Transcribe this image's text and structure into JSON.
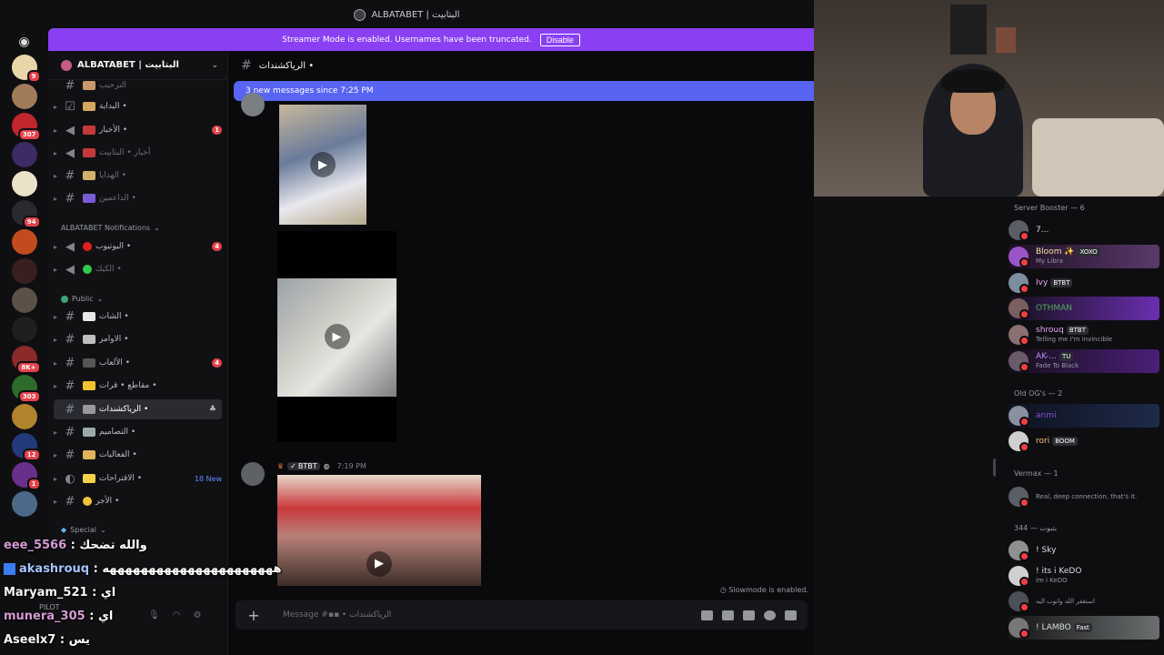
{
  "window": {
    "title": "ALBATABET | البتابيت"
  },
  "banner": {
    "text": "Streamer Mode is enabled. Usernames have been truncated.",
    "button": "Disable"
  },
  "server": {
    "name": "ALBATABET | البتابيت"
  },
  "server_rail": {
    "badges": [
      "9",
      "307",
      "94",
      "8K+",
      "303",
      "12",
      "1"
    ]
  },
  "sidebar": {
    "channels_top": [
      {
        "name": "الترحيب"
      },
      {
        "name": "البداية •"
      },
      {
        "name": "الأخبار •",
        "badge": "1"
      },
      {
        "name": "أخبار • البتابيت"
      },
      {
        "name": "الهدايا •"
      },
      {
        "name": "الداعمين •"
      }
    ],
    "category_notifications": "ALBATABET Notifications",
    "notifications": [
      {
        "name": "اليوتيوب •",
        "badge": "4"
      },
      {
        "name": "الكيك •"
      }
    ],
    "category_public": "Public",
    "public": [
      {
        "name": "الشات •"
      },
      {
        "name": "الاوامر •"
      },
      {
        "name": "الألعاب •",
        "badge": "4"
      },
      {
        "name": "مقاطع • قرات •"
      },
      {
        "name": "الرياكشندات •"
      },
      {
        "name": "التصاميم •"
      },
      {
        "name": "الفعاليات •"
      },
      {
        "name": "الاقتراحات •",
        "new": "18 New"
      },
      {
        "name": "الأجر •"
      }
    ],
    "category_special": "Special",
    "user_label": "PILOT"
  },
  "chat": {
    "channel_name": "الرياكشندات •",
    "new_messages": "3 new messages since 7:25 PM",
    "message_tag": "BTBT",
    "message_time": "7:19 PM",
    "slowmode": "Slowmode is enabled.",
    "composer_placeholder": "Message #▪▪ • الرياكشندات"
  },
  "members": {
    "groups": [
      {
        "title": "Server Booster — 6"
      },
      {
        "title": "Old OG's — 2"
      },
      {
        "title": "Vermax — 1"
      },
      {
        "title": "بتبوت — 344"
      }
    ],
    "list": [
      {
        "name": "7...",
        "sub": ""
      },
      {
        "name": "Bloom ✨",
        "tag": "XOXO",
        "sub": "My Libra"
      },
      {
        "name": "Ivy",
        "tag": "BTBT",
        "sub": ""
      },
      {
        "name": "OTHMAN",
        "sub": ""
      },
      {
        "name": "shrouq",
        "tag": "BTBT",
        "sub": "Telling me I'm invincible"
      },
      {
        "name": "AK-...",
        "tag": "TU",
        "sub": "Fade To Black"
      },
      {
        "name": "anmi",
        "sub": ""
      },
      {
        "name": "rori",
        "tag": "BOOM",
        "sub": ""
      },
      {
        "name": "",
        "sub": "Real, deep connection, that's it."
      },
      {
        "name": "! Sky",
        "sub": ""
      },
      {
        "name": "! its i KeDO",
        "sub": "im i KeDO"
      },
      {
        "name": "",
        "sub": "استغفر الله واتوب اليه"
      },
      {
        "name": "! LAMBO",
        "tag": "Fast",
        "sub": ""
      }
    ]
  },
  "stream_chat": [
    {
      "user": "eee_5566",
      "msg": ": والله تضحك"
    },
    {
      "user": "akashrouq",
      "msg": ": ههههههههههههههههههههههه"
    },
    {
      "user": "Maryam_521",
      "msg": ": اي"
    },
    {
      "user": "munera_305",
      "msg": ": اي"
    },
    {
      "user": "Aseelx7",
      "msg": ": يس"
    }
  ],
  "colors": {
    "banner": "#8a40f2",
    "new_messages": "#5865f2",
    "badge": "#e3424a"
  }
}
